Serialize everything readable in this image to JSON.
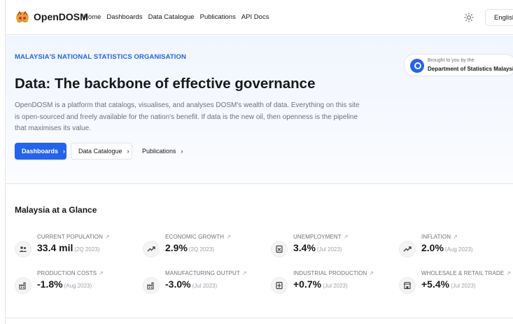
{
  "header": {
    "brand": "OpenDOSM",
    "nav": [
      "Home",
      "Dashboards",
      "Data Catalogue",
      "Publications",
      "API Docs"
    ],
    "language": "English",
    "language_chevron": "⌄"
  },
  "hero": {
    "label": "MALAYSIA'S NATIONAL STATISTICS ORGANISATION",
    "title": "Data: The backbone of effective governance",
    "description": "OpenDOSM is a platform that catalogs, visualises, and analyses DOSM's wealth of data. Everything on this site is open-sourced and freely available for the nation's benefit. If data is the new oil, then openness is the pipeline that maximises its value.",
    "buttons": {
      "dashboards": "Dashboards",
      "data_catalogue": "Data Catalogue",
      "publications": "Publications"
    },
    "chevron": "›",
    "credit": {
      "line1": "Brought to you by the",
      "line2": "Department of Statistics Malaysia"
    }
  },
  "glance": {
    "title": "Malaysia at a Glance",
    "stats": [
      {
        "label": "CURRENT POPULATION",
        "value": "33.4 mil",
        "period": "(2Q 2023)",
        "icon": "people-icon"
      },
      {
        "label": "ECONOMIC GROWTH",
        "value": "2.9%",
        "period": "(2Q 2023)",
        "icon": "trend-up-icon"
      },
      {
        "label": "UNEMPLOYMENT",
        "value": "3.4%",
        "period": "(Jul 2023)",
        "icon": "unemployment-icon"
      },
      {
        "label": "INFLATION",
        "value": "2.0%",
        "period": "(Aug 2023)",
        "icon": "trend-up-icon"
      },
      {
        "label": "PRODUCTION COSTS",
        "value": "-1.8%",
        "period": "(Aug 2023)",
        "icon": "factory-icon"
      },
      {
        "label": "MANUFACTURING OUTPUT",
        "value": "-3.0%",
        "period": "(Jul 2023)",
        "icon": "factory-icon"
      },
      {
        "label": "INDUSTRIAL PRODUCTION",
        "value": "+0.7%",
        "period": "(Jul 2023)",
        "icon": "industry-icon"
      },
      {
        "label": "WHOLESALE & RETAIL TRADE",
        "value": "+5.4%",
        "period": "(Jul 2023)",
        "icon": "store-icon"
      }
    ]
  },
  "colors": {
    "accent": "#2563eb",
    "text": "#18181b",
    "muted": "#71717a"
  }
}
